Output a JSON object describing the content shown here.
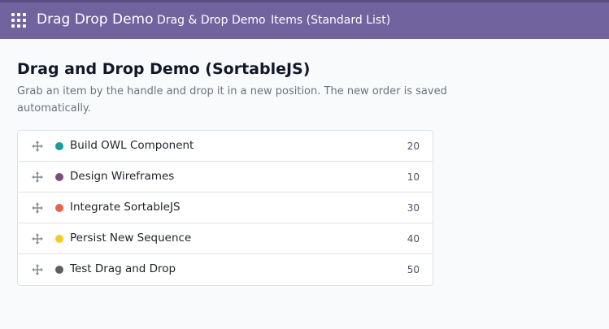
{
  "header": {
    "brand": "Drag Drop Demo",
    "menu": [
      "Drag & Drop Demo",
      "Items (Standard List)"
    ]
  },
  "main": {
    "title": "Drag and Drop Demo (SortableJS)",
    "description": "Grab an item by the handle and drop it in a new position. The new order is saved automatically."
  },
  "items": [
    {
      "name": "Build OWL Component",
      "sequence": "20",
      "color": "#1a9c9c"
    },
    {
      "name": "Design Wireframes",
      "sequence": "10",
      "color": "#7b4f7a"
    },
    {
      "name": "Integrate SortableJS",
      "sequence": "30",
      "color": "#e8654a"
    },
    {
      "name": "Persist New Sequence",
      "sequence": "40",
      "color": "#f2cc2c"
    },
    {
      "name": "Test Drag and Drop",
      "sequence": "50",
      "color": "#5f5f5f"
    }
  ],
  "icons": {
    "apps": "apps-grid-icon",
    "handle": "drag-handle-icon"
  }
}
